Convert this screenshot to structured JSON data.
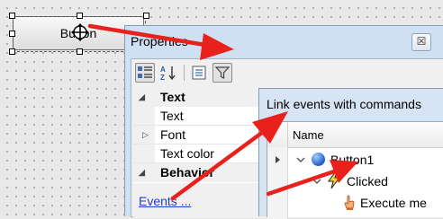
{
  "designer": {
    "button_label": "Button"
  },
  "properties": {
    "title": "Properties",
    "close_glyph": "☒",
    "toolbar": {
      "buttons": [
        "categorized-icon",
        "alphabetical-icon",
        "property-pages-icon",
        "filter-events-icon"
      ]
    },
    "grid": {
      "categories": [
        {
          "label": "Text",
          "items": [
            "Text",
            "Font",
            "Text color"
          ]
        },
        {
          "label": "Behavior"
        }
      ]
    },
    "events_link": "Events ..."
  },
  "link_dialog": {
    "title": "Link events with commands",
    "column_header": "Name",
    "tree": [
      {
        "label": "Button1",
        "icon": "blue-circle-icon"
      },
      {
        "label": "Clicked",
        "icon": "lightning-icon"
      },
      {
        "label": "Execute me",
        "icon": "hand-icon"
      }
    ]
  },
  "colors": {
    "arrow": "#e8211c",
    "link": "#1a3fd6",
    "panel": "#cfe0f2"
  }
}
